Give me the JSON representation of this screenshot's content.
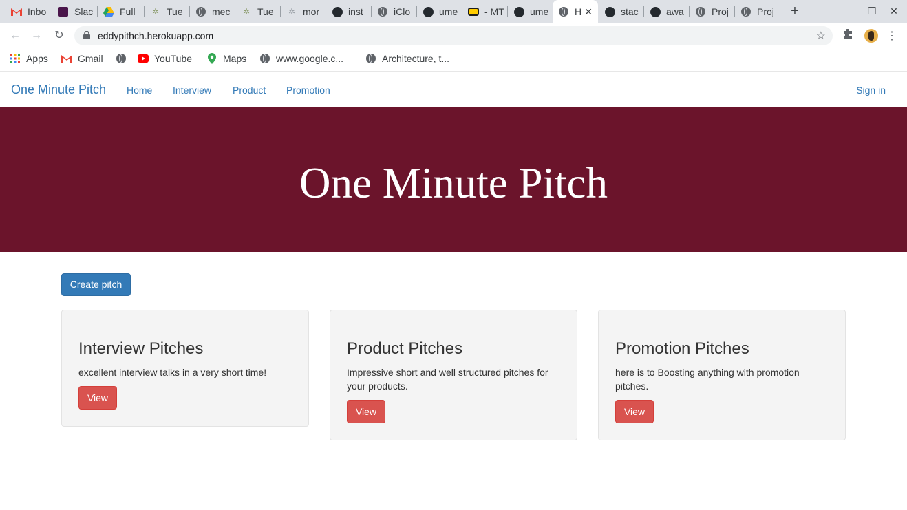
{
  "browser": {
    "tabs": [
      {
        "label": "Inbo",
        "icon": "gmail-icon"
      },
      {
        "label": "Slac",
        "icon": "slack-icon"
      },
      {
        "label": "Full",
        "icon": "google-drive-icon"
      },
      {
        "label": "Tue",
        "icon": "tree-icon"
      },
      {
        "label": "mec",
        "icon": "globe-icon"
      },
      {
        "label": "Tue",
        "icon": "tree-icon"
      },
      {
        "label": "mor",
        "icon": "tree-icon"
      },
      {
        "label": "inst",
        "icon": "github-icon"
      },
      {
        "label": "iClo",
        "icon": "globe-icon"
      },
      {
        "label": "ume",
        "icon": "github-icon"
      },
      {
        "label": "- MT",
        "icon": "mtn-icon"
      },
      {
        "label": "ume",
        "icon": "github-icon"
      },
      {
        "label": "H",
        "icon": "globe-icon",
        "active": true
      },
      {
        "label": "stac",
        "icon": "github-icon"
      },
      {
        "label": "awa",
        "icon": "github-icon"
      },
      {
        "label": "Proj",
        "icon": "globe-icon"
      },
      {
        "label": "Proj",
        "icon": "globe-icon"
      }
    ],
    "url": "eddypithch.herokuapp.com",
    "bookmarks": [
      {
        "label": "Apps",
        "icon": "apps-grid-icon"
      },
      {
        "label": "Gmail",
        "icon": "gmail-icon"
      },
      {
        "label": "",
        "icon": "globe-icon"
      },
      {
        "label": "YouTube",
        "icon": "youtube-icon"
      },
      {
        "label": "Maps",
        "icon": "maps-pin-icon"
      },
      {
        "label": "www.google.c...",
        "icon": "globe-icon"
      },
      {
        "label": "Architecture, t...",
        "icon": "globe-icon"
      }
    ]
  },
  "navbar": {
    "brand": "One Minute Pitch",
    "links": [
      "Home",
      "Interview",
      "Product",
      "Promotion"
    ],
    "signin": "Sign in"
  },
  "hero": {
    "title": "One Minute Pitch"
  },
  "main": {
    "create_button": "Create pitch",
    "cards": [
      {
        "title": "Interview Pitches",
        "description": "excellent interview talks in a very short time!",
        "button": "View"
      },
      {
        "title": "Product Pitches",
        "description": "Impressive short and well structured pitches for your products.",
        "button": "View"
      },
      {
        "title": "Promotion Pitches",
        "description": "here is to Boosting anything with promotion pitches.",
        "button": "View"
      }
    ]
  },
  "colors": {
    "hero_bg": "#6b142b",
    "link": "#337ab7",
    "primary_btn": "#337ab7",
    "danger_btn": "#d9534f",
    "card_bg": "#f4f4f4"
  }
}
